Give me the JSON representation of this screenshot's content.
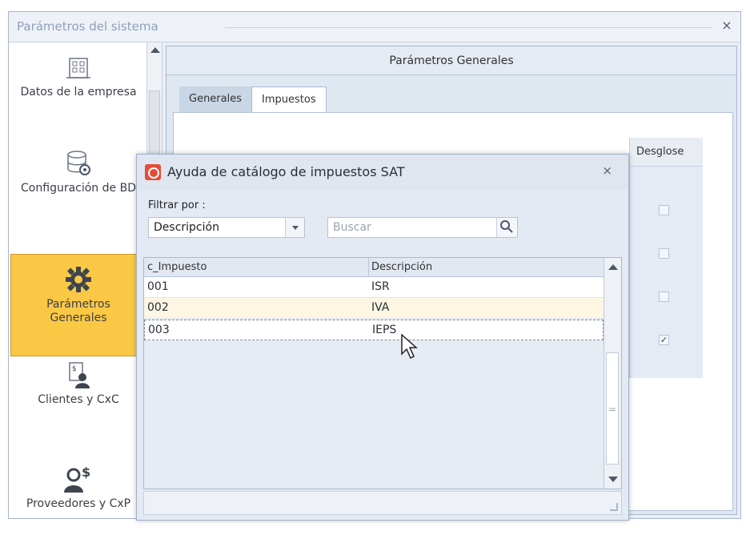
{
  "window": {
    "title": "Parámetros del sistema",
    "close_icon": "×"
  },
  "nav": {
    "items": [
      {
        "label": "Datos de la empresa",
        "icon": "building-icon"
      },
      {
        "label": "Configuración de BD",
        "icon": "database-settings-icon"
      },
      {
        "label": "Parámetros Generales",
        "icon": "gear-icon",
        "active": true
      },
      {
        "label": "Clientes y CxC",
        "icon": "clients-icon"
      },
      {
        "label": "Proveedores y CxP",
        "icon": "vendor-icon"
      }
    ]
  },
  "content": {
    "header": "Parámetros Generales",
    "tabs": [
      {
        "label": "Generales"
      },
      {
        "label": "Impuestos"
      }
    ],
    "desglose_header": "Desglose",
    "desglose_checks": [
      false,
      false,
      false,
      true
    ]
  },
  "dialog": {
    "title": "Ayuda de catálogo de impuestos SAT",
    "close_icon": "×",
    "filter_label": "Filtrar por :",
    "filter_value": "Descripción",
    "search_placeholder": "Buscar",
    "columns": [
      "c_Impuesto",
      "Descripción"
    ],
    "rows": [
      {
        "code": "001",
        "desc": "ISR"
      },
      {
        "code": "002",
        "desc": "IVA"
      },
      {
        "code": "003",
        "desc": "IEPS"
      }
    ],
    "scroll_thumb_mark": "="
  },
  "colors": {
    "active_nav": "#fbc845",
    "dialog_icon": "#e64c39"
  }
}
